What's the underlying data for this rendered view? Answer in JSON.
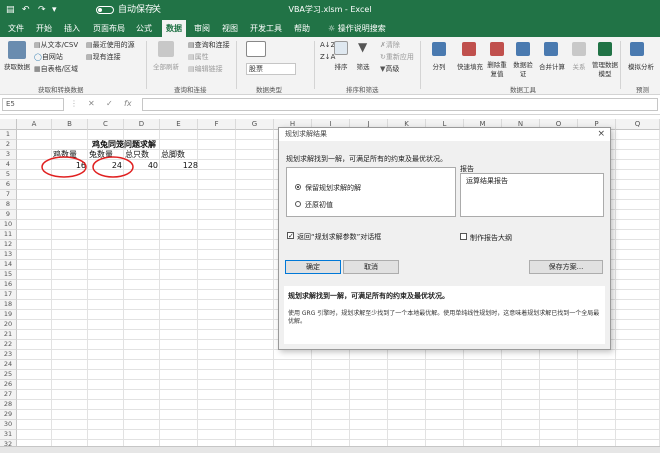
{
  "titlebar": {
    "autosave_label": "自动保存",
    "autosave_state": "关",
    "title": "VBA学习.xlsm  -  Excel"
  },
  "tabs": [
    "文件",
    "开始",
    "插入",
    "页面布局",
    "公式",
    "数据",
    "审阅",
    "视图",
    "开发工具",
    "帮助",
    "操作说明搜索"
  ],
  "ribbon": {
    "get_data": "获取数据",
    "from_text_csv": "从文本/CSV",
    "from_web": "自网站",
    "from_table": "自表格/区域",
    "recent_sources": "最近使用的源",
    "existing_connections": "现有连接",
    "group_get_transform": "获取和转换数据",
    "refresh_all": "全部刷新",
    "queries_connections": "查询和连接",
    "properties": "属性",
    "edit_links": "编辑链接",
    "group_queries": "查询和连接",
    "stocks": "股票",
    "group_data_types": "数据类型",
    "sort": "排序",
    "filter": "筛选",
    "clear": "清除",
    "reapply": "重新应用",
    "advanced": "高级",
    "group_sort_filter": "排序和筛选",
    "text_to_columns": "分列",
    "flash_fill": "快速填充",
    "remove_duplicates": "删除重复值",
    "data_validation": "数据验证",
    "consolidate": "合并计算",
    "relationships": "关系",
    "manage_data_model": "管理数据模型",
    "group_data_tools": "数据工具",
    "what_if": "模拟分析",
    "group_forecast": "预测"
  },
  "formula_bar": {
    "name_box": "E5",
    "fx": "fx"
  },
  "columns": [
    "A",
    "B",
    "C",
    "D",
    "E",
    "F",
    "G",
    "H",
    "I",
    "J",
    "K",
    "L",
    "M",
    "N",
    "O",
    "P",
    "Q"
  ],
  "rows": [
    "1",
    "2",
    "3",
    "4",
    "5",
    "6",
    "7",
    "8",
    "9",
    "10",
    "11",
    "12",
    "13",
    "14",
    "15",
    "16",
    "17",
    "18",
    "19",
    "20",
    "21",
    "22",
    "23",
    "24",
    "25",
    "26",
    "27",
    "28",
    "29",
    "30",
    "31",
    "32"
  ],
  "sheet": {
    "title": "鸡兔同笼问题求解",
    "headers": [
      "鸡数量",
      "兔数量",
      "总只数",
      "总脚数"
    ],
    "values": [
      "16",
      "24",
      "40",
      "128"
    ]
  },
  "dialog": {
    "title": "规划求解结果",
    "message": "规划求解找到一解，可满足所有的约束及最优状况。",
    "report_label": "报告",
    "report_items": [
      "运算结果报告"
    ],
    "keep_solution": "保留规划求解的解",
    "restore_values": "还原初值",
    "return_to_params": "返回“规划求解参数”对话框",
    "outline_reports": "制作报告大纲",
    "ok": "确定",
    "cancel": "取消",
    "save_scenario": "保存方案...",
    "result_heading": "规划求解找到一解，可满足所有的约束及最优状况。",
    "result_detail": "使用 GRG 引擎时，规划求解至少找到了一个本地最优解。使用单纯线性规划时，这意味着规划求解已找到一个全局最优解。"
  },
  "colors": {
    "excel_green": "#217346",
    "highlight_red": "#e02020"
  }
}
